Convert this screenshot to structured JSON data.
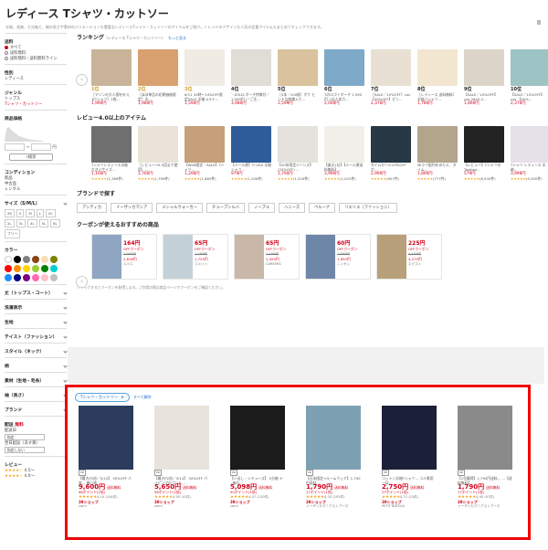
{
  "header": {
    "title": "レディース Tシャツ・カットソー",
    "subtitle": "半袖、長袖、七分袖と、袖の長さや素材のバリエーションも豊富なレディースTシャツ・カットソーのアイテムをご紹介。トレンドのデザインも人気の定番アイテムもまとめてチェックできます。"
  },
  "sidebar": {
    "order_label": "並べ替え・絞り込み",
    "kind_title": "送料",
    "kind_items": [
      "すべて",
      "送料無料",
      "送料無料・送料無料ライン"
    ],
    "gender_title": "性別",
    "gender_value": "レディース",
    "genre_title": "ジャンル",
    "genre_parent": "トップス",
    "genre_current": "Tシャツ・カットソー",
    "price_title": "商品価格",
    "price_sep": "〜",
    "price_unit": "円",
    "search_btn": "検索",
    "cond_title": "コンディション",
    "cond_items": [
      "新品",
      "中古品",
      "レンタル"
    ],
    "size_title": "サイズ（S/M/L）",
    "sizes": [
      "XS",
      "S",
      "M",
      "L",
      "XL",
      "2L",
      "3L",
      "4L",
      "5L",
      "6L",
      "フリー"
    ],
    "color_title": "カラー",
    "colors": [
      "#ffffff",
      "#000000",
      "#808080",
      "#8b4513",
      "#f5deb3",
      "#808000",
      "#ff0000",
      "#ff8c00",
      "#ffd700",
      "#9acd32",
      "#008000",
      "#00ced1",
      "#1e90ff",
      "#000080",
      "#800080",
      "#ff69b4",
      "#ffc0cb",
      "#c0c0c0"
    ],
    "more": [
      "丈（トップス・コート）",
      "洗濯表示",
      "生地",
      "テイスト（ファッション）",
      "スタイル（ネック）",
      "柄",
      "素材（生地・毛糸）",
      "袖（長さ）",
      "ブランド"
    ],
    "shipping_title": "配送",
    "shipping_value": "無料",
    "ship_label": "配送日",
    "ship_select": "指定",
    "ship_label2": "翌日配送（あす楽）",
    "ship_select2": "指定しない",
    "review_title": "レビュー",
    "review_1": "4.5〜",
    "review_2": "4.0〜"
  },
  "ranking": {
    "title": "ランキング",
    "subtitle": "（レディース Tシャツ・カットソー）",
    "more": "もっと見る",
    "items": [
      {
        "rank": "1位",
        "desc": "［マリンの大人顔を叶えるTシャツ］1枚...",
        "price": "1,990円",
        "img": "#c9b49a"
      },
      {
        "rank": "2位",
        "desc": "［ほぼ単品の初期価格限定］半...",
        "price": "1,980円",
        "img": "#d9a070"
      },
      {
        "rank": "3位",
        "desc": "6/11 10時～14%OFF限定SALE 半袖 Aライ...",
        "price": "1,590円",
        "img": "#f0ece4"
      },
      {
        "rank": "4位",
        "desc": "＼SOLD-ポーチ特典付／1,599円 (^ご注...",
        "price": "3,980円",
        "img": "#e0dcd6"
      },
      {
        "rank": "5位",
        "desc": "［5本・100枚］ポケ ヒントな刺繍入り...",
        "price": "1,599円",
        "img": "#d9c29d"
      },
      {
        "rank": "6位",
        "desc": "7のロゴ＋ポーチ 1,590円 ▽は人気カ...",
        "price": "2,000円",
        "img": "#7fa9c9"
      },
      {
        "rank": "7位",
        "desc": "［SALE／10%OFF］cos 【40%OFF】ピン...",
        "price": "2,376円",
        "img": "#e8e1d3"
      },
      {
        "rank": "8位",
        "desc": "［レディース 送料無料］半袖 Tシャツ...",
        "price": "1,780円",
        "img": "#f2e6d0"
      },
      {
        "rank": "9位",
        "desc": "【SALE／10%OFF】 cos 2640-2...",
        "price": "1,890円",
        "img": "#dcd4c8"
      },
      {
        "rank": "10位",
        "desc": "【SALE／10%OFF】 cos 【40%...",
        "price": "2,376円",
        "img": "#9ec3c4"
      }
    ]
  },
  "review_sec": {
    "title": "レビュー4.0以上のアイテム",
    "items": [
      {
        "desc": "Tシャツレディース半袖 大きいサイズ...",
        "price": "1,100円",
        "rv": "(1,386件)",
        "img": "#6f6f6f"
      },
      {
        "desc": "［レビュー→5.5回まで使用］...",
        "price": "1,760円",
        "rv": "(1,799件)",
        "img": "#e9e3d9"
      },
      {
        "desc": "【WEB限定・SALE】Tシャツ...",
        "price": "1,290円",
        "rv": "(1,885件)",
        "img": "#c5a07a"
      },
      {
        "desc": "【メール便】Ti USA 半袖シャツ...",
        "price": "979円",
        "rv": "(1,206件)",
        "img": "#2f5c9b"
      },
      {
        "desc": "【50年限定ジーンズ】(20%OFF) ...",
        "price": "1,790円",
        "rv": "(1,516件)",
        "img": "#e5e1dc"
      },
      {
        "desc": "【楽天1位】【メール便送料無料】...",
        "price": "3,990円",
        "rv": "(1,025件)",
        "img": "#f0efe9"
      },
      {
        "desc": "タイムセール23％OFF ポ...",
        "price": "2,990円",
        "rv": "(907件)",
        "img": "#283845"
      },
      {
        "desc": "MIラフ配列をみたエ、タイム...",
        "price": "1,890円",
        "rv": "(777件)",
        "img": "#b3a48c"
      },
      {
        "desc": "【レビュー】Tシャツの Toolbox...",
        "price": "579円",
        "rv": "(6,530件)",
        "img": "#222222"
      },
      {
        "desc": "Tシャツ レディース 半袖...",
        "price": "3,999円",
        "rv": "(5,000件)",
        "img": "#e6e0e8"
      }
    ]
  },
  "brands": {
    "title": "ブランドで探す",
    "items": [
      "アンティカ",
      "イーザッカマニア",
      "メシャルウォーカー",
      "チュ一ブシルバ",
      "ノーブル",
      "ハニーズ",
      "ベルーナ",
      "リエリエ（ファッション）"
    ]
  },
  "coupons": {
    "title": "クーポンが使えるおすすめの商品",
    "items": [
      {
        "amount": "164円",
        "label": "OFFクーポン",
        "old": "2,980円",
        "now": "2,816円",
        "shop": "ルミエ",
        "img": "#8fa6c2"
      },
      {
        "amount": "65円",
        "label": "OFFクーポン",
        "old": "1,790円",
        "now": "1,725円",
        "shop": "コメット",
        "img": "#c4d0d8"
      },
      {
        "amount": "65円",
        "label": "OFFクーポン",
        "old": "1,490円",
        "now": "1,425円",
        "shop": "CAREERS",
        "img": "#c9b8a8"
      },
      {
        "amount": "60円",
        "label": "OFFクーポン",
        "old": "1,890円",
        "now": "1,830円",
        "shop": "ニッセン",
        "img": "#6e86a8"
      },
      {
        "amount": "225円",
        "label": "OFFクーポン",
        "old": "4,500円",
        "now": "4,275円",
        "shop": "ネクスト",
        "img": "#b7a079"
      }
    ],
    "note": "クリックするとクーポンを取得します。ご利用の際は商品ページでクーポンをご確認ください。"
  },
  "tabs": {
    "active": "Tシャツ・カットソー",
    "link": "すべて解除"
  },
  "products": [
    {
      "desc": "【最大P2倍／5/14】 30%OFF 人気... 着心地...",
      "price": "9,600円",
      "tax": "送料無料",
      "pts": "96ポイント(1倍)",
      "rv": "4.14 (104件)",
      "shop": "39ショップ",
      "store": "comi",
      "img": "#2b3c5c"
    },
    {
      "desc": "【最大P2倍／5/14】 30%OFF パイピングのフリル...",
      "price": "5,650円",
      "tax": "送料無料",
      "pts": "56ポイント(1倍)",
      "rv": "4.50 (41件)",
      "shop": "39ショップ",
      "store": "comi",
      "img": "#e8e4dc"
    },
    {
      "desc": "【シ出し・シミューズ】 5分袖 テ ..袖の...",
      "price": "5,098円",
      "tax": "送料無料",
      "pts": "50ポイント(1倍)",
      "rv": "4.57 (120件)",
      "shop": "39ショップ",
      "store": "comi",
      "img": "#1b1b1b"
    },
    {
      "desc": "【日本限定→ルームウェア】1,790円送料... ...",
      "price": "1,790円",
      "tax": "送料無料",
      "pts": "17ポイント(1倍)",
      "rv": "4.33 (105件)",
      "shop": "39ショップ",
      "store": "イーザッカマニアストアーズ",
      "img": "#7ea0b3"
    },
    {
      "desc": "コットン半袖Tシャツ... コメ専用一括...",
      "price": "2,750円",
      "tax": "送料無料",
      "pts": "27ポイント(1倍)",
      "rv": "4.71 (13件)",
      "shop": "39ショップ",
      "store": "PETIT BATEAU",
      "img": "#1c1f38"
    },
    {
      "desc": "【1位獲得】1,790円送料... ...【送料無料】...",
      "price": "1,790円",
      "tax": "送料無料",
      "pts": "17ポイント(1倍)",
      "rv": "4.40 (97件)",
      "shop": "39ショップ",
      "store": "イーザッカマニアストアーズ",
      "img": "#8a8a8a"
    }
  ]
}
